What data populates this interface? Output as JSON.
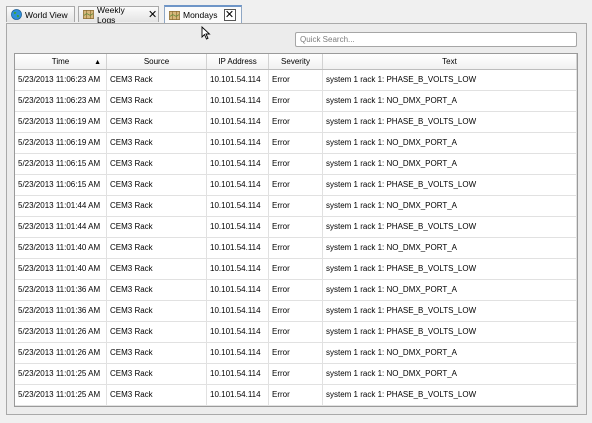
{
  "tabs": [
    {
      "label": "World View",
      "icon": "globe-icon",
      "active": false,
      "closable": false
    },
    {
      "label": "Weekly Logs",
      "icon": "map-icon",
      "active": false,
      "closable": true
    },
    {
      "label": "Mondays",
      "icon": "map-icon",
      "active": true,
      "closable": true
    }
  ],
  "search": {
    "placeholder": "Quick Search..."
  },
  "table": {
    "columns": [
      "Time",
      "Source",
      "IP Address",
      "Severity",
      "Text"
    ],
    "sort_column": "Time",
    "sort_direction": "ascending",
    "rows": [
      [
        "5/23/2013 11:06:23 AM",
        "CEM3 Rack",
        "10.101.54.114",
        "Error",
        "system 1 rack 1: PHASE_B_VOLTS_LOW"
      ],
      [
        "5/23/2013 11:06:23 AM",
        "CEM3 Rack",
        "10.101.54.114",
        "Error",
        "system 1 rack 1: NO_DMX_PORT_A"
      ],
      [
        "5/23/2013 11:06:19 AM",
        "CEM3 Rack",
        "10.101.54.114",
        "Error",
        "system 1 rack 1: PHASE_B_VOLTS_LOW"
      ],
      [
        "5/23/2013 11:06:19 AM",
        "CEM3 Rack",
        "10.101.54.114",
        "Error",
        "system 1 rack 1: NO_DMX_PORT_A"
      ],
      [
        "5/23/2013 11:06:15 AM",
        "CEM3 Rack",
        "10.101.54.114",
        "Error",
        "system 1 rack 1: NO_DMX_PORT_A"
      ],
      [
        "5/23/2013 11:06:15 AM",
        "CEM3 Rack",
        "10.101.54.114",
        "Error",
        "system 1 rack 1: PHASE_B_VOLTS_LOW"
      ],
      [
        "5/23/2013 11:01:44 AM",
        "CEM3 Rack",
        "10.101.54.114",
        "Error",
        "system 1 rack 1: NO_DMX_PORT_A"
      ],
      [
        "5/23/2013 11:01:44 AM",
        "CEM3 Rack",
        "10.101.54.114",
        "Error",
        "system 1 rack 1: PHASE_B_VOLTS_LOW"
      ],
      [
        "5/23/2013 11:01:40 AM",
        "CEM3 Rack",
        "10.101.54.114",
        "Error",
        "system 1 rack 1: NO_DMX_PORT_A"
      ],
      [
        "5/23/2013 11:01:40 AM",
        "CEM3 Rack",
        "10.101.54.114",
        "Error",
        "system 1 rack 1: PHASE_B_VOLTS_LOW"
      ],
      [
        "5/23/2013 11:01:36 AM",
        "CEM3 Rack",
        "10.101.54.114",
        "Error",
        "system 1 rack 1: NO_DMX_PORT_A"
      ],
      [
        "5/23/2013 11:01:36 AM",
        "CEM3 Rack",
        "10.101.54.114",
        "Error",
        "system 1 rack 1: PHASE_B_VOLTS_LOW"
      ],
      [
        "5/23/2013 11:01:26 AM",
        "CEM3 Rack",
        "10.101.54.114",
        "Error",
        "system 1 rack 1: PHASE_B_VOLTS_LOW"
      ],
      [
        "5/23/2013 11:01:26 AM",
        "CEM3 Rack",
        "10.101.54.114",
        "Error",
        "system 1 rack 1: NO_DMX_PORT_A"
      ],
      [
        "5/23/2013 11:01:25 AM",
        "CEM3 Rack",
        "10.101.54.114",
        "Error",
        "system 1 rack 1: NO_DMX_PORT_A"
      ],
      [
        "5/23/2013 11:01:25 AM",
        "CEM3 Rack",
        "10.101.54.114",
        "Error",
        "system 1 rack 1: PHASE_B_VOLTS_LOW"
      ]
    ]
  },
  "colors": {
    "active_tab_accent": "#6e95c7",
    "border": "#a9a9a9"
  }
}
